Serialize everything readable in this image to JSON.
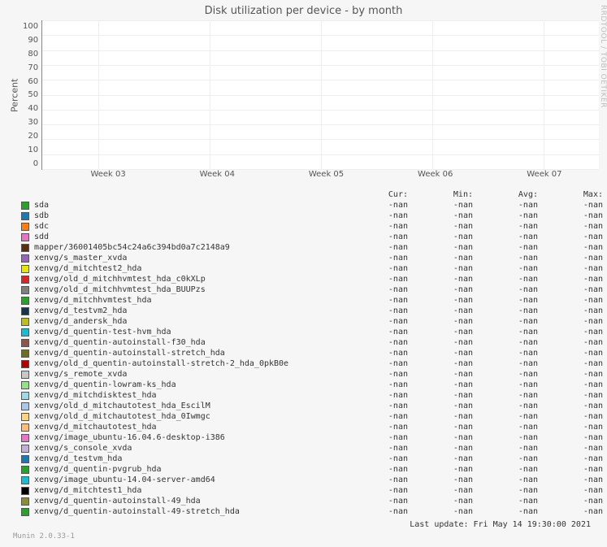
{
  "title": "Disk utilization per device - by month",
  "ylabel": "Percent",
  "side_credit": "RRDTOOL / TOBI OETIKER",
  "footer_version": "Munin 2.0.33-1",
  "last_update": "Last update: Fri May 14 19:30:00 2021",
  "headers": {
    "name": "",
    "cur": "Cur:",
    "min": "Min:",
    "avg": "Avg:",
    "max": "Max:"
  },
  "yticks": [
    "100",
    "90",
    "80",
    "70",
    "60",
    "50",
    "40",
    "30",
    "20",
    "10",
    "0"
  ],
  "xticks": [
    {
      "label": "Week 03",
      "pct": 10
    },
    {
      "label": "Week 04",
      "pct": 30
    },
    {
      "label": "Week 05",
      "pct": 50
    },
    {
      "label": "Week 06",
      "pct": 70
    },
    {
      "label": "Week 07",
      "pct": 90
    }
  ],
  "series": [
    {
      "color": "#2ca02c",
      "name": "sda",
      "cur": "-nan",
      "min": "-nan",
      "avg": "-nan",
      "max": "-nan"
    },
    {
      "color": "#1f77b4",
      "name": "sdb",
      "cur": "-nan",
      "min": "-nan",
      "avg": "-nan",
      "max": "-nan"
    },
    {
      "color": "#ff7f0e",
      "name": "sdc",
      "cur": "-nan",
      "min": "-nan",
      "avg": "-nan",
      "max": "-nan"
    },
    {
      "color": "#e377c2",
      "name": "sdd",
      "cur": "-nan",
      "min": "-nan",
      "avg": "-nan",
      "max": "-nan"
    },
    {
      "color": "#5a2e0f",
      "name": "mapper/36001405bc54c24a6c394bd0a7c2148a9",
      "cur": "-nan",
      "min": "-nan",
      "avg": "-nan",
      "max": "-nan"
    },
    {
      "color": "#9467bd",
      "name": "xenvg/s_master_xvda",
      "cur": "-nan",
      "min": "-nan",
      "avg": "-nan",
      "max": "-nan"
    },
    {
      "color": "#e6e600",
      "name": "xenvg/d_mitchtest2_hda",
      "cur": "-nan",
      "min": "-nan",
      "avg": "-nan",
      "max": "-nan"
    },
    {
      "color": "#d62728",
      "name": "xenvg/old_d_mitchhvmtest_hda_c0kXLp",
      "cur": "-nan",
      "min": "-nan",
      "avg": "-nan",
      "max": "-nan"
    },
    {
      "color": "#7f7f7f",
      "name": "xenvg/old_d_mitchhvmtest_hda_BUUPzs",
      "cur": "-nan",
      "min": "-nan",
      "avg": "-nan",
      "max": "-nan"
    },
    {
      "color": "#2ca02c",
      "name": "xenvg/d_mitchhvmtest_hda",
      "cur": "-nan",
      "min": "-nan",
      "avg": "-nan",
      "max": "-nan"
    },
    {
      "color": "#17344f",
      "name": "xenvg/d_testvm2_hda",
      "cur": "-nan",
      "min": "-nan",
      "avg": "-nan",
      "max": "-nan"
    },
    {
      "color": "#bcbd22",
      "name": "xenvg/d_andersk_hda",
      "cur": "-nan",
      "min": "-nan",
      "avg": "-nan",
      "max": "-nan"
    },
    {
      "color": "#17becf",
      "name": "xenvg/d_quentin-test-hvm_hda",
      "cur": "-nan",
      "min": "-nan",
      "avg": "-nan",
      "max": "-nan"
    },
    {
      "color": "#8c564b",
      "name": "xenvg/d_quentin-autoinstall-f30_hda",
      "cur": "-nan",
      "min": "-nan",
      "avg": "-nan",
      "max": "-nan"
    },
    {
      "color": "#6b6e23",
      "name": "xenvg/d_quentin-autoinstall-stretch_hda",
      "cur": "-nan",
      "min": "-nan",
      "avg": "-nan",
      "max": "-nan"
    },
    {
      "color": "#b20000",
      "name": "xenvg/old_d_quentin-autoinstall-stretch-2_hda_0pkB0e",
      "cur": "-nan",
      "min": "-nan",
      "avg": "-nan",
      "max": "-nan"
    },
    {
      "color": "#c7c7c7",
      "name": "xenvg/s_remote_xvda",
      "cur": "-nan",
      "min": "-nan",
      "avg": "-nan",
      "max": "-nan"
    },
    {
      "color": "#98df8a",
      "name": "xenvg/d_quentin-lowram-ks_hda",
      "cur": "-nan",
      "min": "-nan",
      "avg": "-nan",
      "max": "-nan"
    },
    {
      "color": "#9edae5",
      "name": "xenvg/d_mitchdisktest_hda",
      "cur": "-nan",
      "min": "-nan",
      "avg": "-nan",
      "max": "-nan"
    },
    {
      "color": "#aec7e8",
      "name": "xenvg/old_d_mitchautotest_hda_EscilM",
      "cur": "-nan",
      "min": "-nan",
      "avg": "-nan",
      "max": "-nan"
    },
    {
      "color": "#ffd27f",
      "name": "xenvg/old_d_mitchautotest_hda_0Iwmgc",
      "cur": "-nan",
      "min": "-nan",
      "avg": "-nan",
      "max": "-nan"
    },
    {
      "color": "#ffbb78",
      "name": "xenvg/d_mitchautotest_hda",
      "cur": "-nan",
      "min": "-nan",
      "avg": "-nan",
      "max": "-nan"
    },
    {
      "color": "#e377c2",
      "name": "xenvg/image_ubuntu-16.04.6-desktop-i386",
      "cur": "-nan",
      "min": "-nan",
      "avg": "-nan",
      "max": "-nan"
    },
    {
      "color": "#c5b0d5",
      "name": "xenvg/s_console_xvda",
      "cur": "-nan",
      "min": "-nan",
      "avg": "-nan",
      "max": "-nan"
    },
    {
      "color": "#1f77b4",
      "name": "xenvg/d_testvm_hda",
      "cur": "-nan",
      "min": "-nan",
      "avg": "-nan",
      "max": "-nan"
    },
    {
      "color": "#2ca02c",
      "name": "xenvg/d_quentin-pvgrub_hda",
      "cur": "-nan",
      "min": "-nan",
      "avg": "-nan",
      "max": "-nan"
    },
    {
      "color": "#17becf",
      "name": "xenvg/image_ubuntu-14.04-server-amd64",
      "cur": "-nan",
      "min": "-nan",
      "avg": "-nan",
      "max": "-nan"
    },
    {
      "color": "#000000",
      "name": "xenvg/d_mitchtest1_hda",
      "cur": "-nan",
      "min": "-nan",
      "avg": "-nan",
      "max": "-nan"
    },
    {
      "color": "#8c8c3d",
      "name": "xenvg/d_quentin-autoinstall-49_hda",
      "cur": "-nan",
      "min": "-nan",
      "avg": "-nan",
      "max": "-nan"
    },
    {
      "color": "#2ca02c",
      "name": "xenvg/d_quentin-autoinstall-49-stretch_hda",
      "cur": "-nan",
      "min": "-nan",
      "avg": "-nan",
      "max": "-nan"
    }
  ],
  "chart_data": {
    "type": "line",
    "title": "Disk utilization per device - by month",
    "xlabel": "",
    "ylabel": "Percent",
    "ylim": [
      0,
      100
    ],
    "x_categories": [
      "Week 03",
      "Week 04",
      "Week 05",
      "Week 06",
      "Week 07"
    ],
    "note": "All series report -nan for Cur/Min/Avg/Max; no data points are plotted.",
    "series": [
      {
        "name": "sda",
        "values": []
      },
      {
        "name": "sdb",
        "values": []
      },
      {
        "name": "sdc",
        "values": []
      },
      {
        "name": "sdd",
        "values": []
      },
      {
        "name": "mapper/36001405bc54c24a6c394bd0a7c2148a9",
        "values": []
      },
      {
        "name": "xenvg/s_master_xvda",
        "values": []
      },
      {
        "name": "xenvg/d_mitchtest2_hda",
        "values": []
      },
      {
        "name": "xenvg/old_d_mitchhvmtest_hda_c0kXLp",
        "values": []
      },
      {
        "name": "xenvg/old_d_mitchhvmtest_hda_BUUPzs",
        "values": []
      },
      {
        "name": "xenvg/d_mitchhvmtest_hda",
        "values": []
      },
      {
        "name": "xenvg/d_testvm2_hda",
        "values": []
      },
      {
        "name": "xenvg/d_andersk_hda",
        "values": []
      },
      {
        "name": "xenvg/d_quentin-test-hvm_hda",
        "values": []
      },
      {
        "name": "xenvg/d_quentin-autoinstall-f30_hda",
        "values": []
      },
      {
        "name": "xenvg/d_quentin-autoinstall-stretch_hda",
        "values": []
      },
      {
        "name": "xenvg/old_d_quentin-autoinstall-stretch-2_hda_0pkB0e",
        "values": []
      },
      {
        "name": "xenvg/s_remote_xvda",
        "values": []
      },
      {
        "name": "xenvg/d_quentin-lowram-ks_hda",
        "values": []
      },
      {
        "name": "xenvg/d_mitchdisktest_hda",
        "values": []
      },
      {
        "name": "xenvg/old_d_mitchautotest_hda_EscilM",
        "values": []
      },
      {
        "name": "xenvg/old_d_mitchautotest_hda_0Iwmgc",
        "values": []
      },
      {
        "name": "xenvg/d_mitchautotest_hda",
        "values": []
      },
      {
        "name": "xenvg/image_ubuntu-16.04.6-desktop-i386",
        "values": []
      },
      {
        "name": "xenvg/s_console_xvda",
        "values": []
      },
      {
        "name": "xenvg/d_testvm_hda",
        "values": []
      },
      {
        "name": "xenvg/d_quentin-pvgrub_hda",
        "values": []
      },
      {
        "name": "xenvg/image_ubuntu-14.04-server-amd64",
        "values": []
      },
      {
        "name": "xenvg/d_mitchtest1_hda",
        "values": []
      },
      {
        "name": "xenvg/d_quentin-autoinstall-49_hda",
        "values": []
      },
      {
        "name": "xenvg/d_quentin-autoinstall-49-stretch_hda",
        "values": []
      }
    ]
  }
}
